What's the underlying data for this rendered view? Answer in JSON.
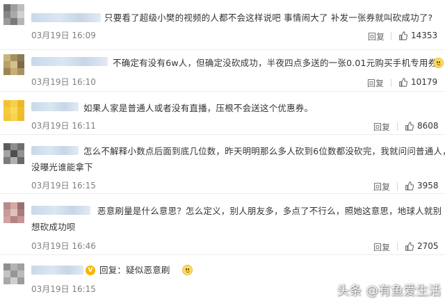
{
  "comments": [
    {
      "text": "只要看了超级小樊的视频的人都不会这样说吧 事情闹大了 补发一张券就叫砍成功了?",
      "time": "03月19日 16:09",
      "reply_label": "回复",
      "likes": "14353",
      "avatar_colors": [
        "#6f6f6f",
        "#9e9e9e",
        "#bdbdbd",
        "#858585",
        "#aaaaaa",
        "#d0d0d0",
        "#9a9a9a",
        "#7a7a7a",
        "#b5b5b5"
      ]
    },
    {
      "text": "不确定有没有6w人，但确定没砍成功，半夜四点多送的一张0.01元购买手机专用券",
      "time": "03月19日 16:10",
      "reply_label": "回复",
      "likes": "10179",
      "trailing_emoji": "grin-emoji",
      "avatar_colors": [
        "#c9b37e",
        "#a5915f",
        "#8a7a55",
        "#b8a06a",
        "#d6c08a",
        "#7d6b45",
        "#9b8554",
        "#c4ae77",
        "#a89263"
      ]
    },
    {
      "text": "如果人家是普通人或者没有直播，压根不会送这个优惠券。",
      "time": "03月19日 16:11",
      "reply_label": "回复",
      "likes": "8608",
      "avatar_colors": [
        "#f2c230",
        "#f7d14a",
        "#eeb823",
        "#f5cc3c",
        "#fad85a",
        "#f0be2c",
        "#f4c738",
        "#f8d34e",
        "#efbb27"
      ]
    },
    {
      "text_lines": [
        "怎么不解释小数点后面到底几位数，昨天明明那么多人砍到6位数都没砍完，我就问问普通人，",
        "没曝光谁能拿下"
      ],
      "time": "03月19日 16:15",
      "reply_label": "回复",
      "likes": "3958",
      "avatar_colors": [
        "#5c5c5c",
        "#8d8d8d",
        "#6e6e6e",
        "#a3a3a3",
        "#4f4f4f",
        "#929292",
        "#7b7b7b",
        "#b1b1b1",
        "#686868"
      ]
    },
    {
      "text_lines": [
        "恶意刷量是什么意思？怎么定义，别人朋友多，多点了不行么，照她这意思，地球人就别",
        "想砍成功呗"
      ],
      "time": "03月19日 16:46",
      "reply_label": "回复",
      "likes": "2705",
      "avatar_colors": [
        "#b98a8a",
        "#d4a9a9",
        "#9c6f6f",
        "#c89b9b",
        "#e2c0c0",
        "#a97c7c",
        "#d1a3a3",
        "#b38484",
        "#c69696"
      ]
    },
    {
      "text": "回复：疑似恶意刷",
      "time": "03月19日 16:15",
      "trailing_emoji": "grin-emoji",
      "avatar_colors": [
        "#8f8f8f",
        "#b3b3b3",
        "#a0a0a0",
        "#c3c3c3",
        "#979797",
        "#bbbbbb",
        "#a8a8a8",
        "#cfcfcf",
        "#9b9b9b"
      ]
    }
  ],
  "like_icon": "thumbs-up-icon",
  "verified_badge_icon": "verified-badge-icon",
  "watermark": "头条 @有鱼爱生活"
}
